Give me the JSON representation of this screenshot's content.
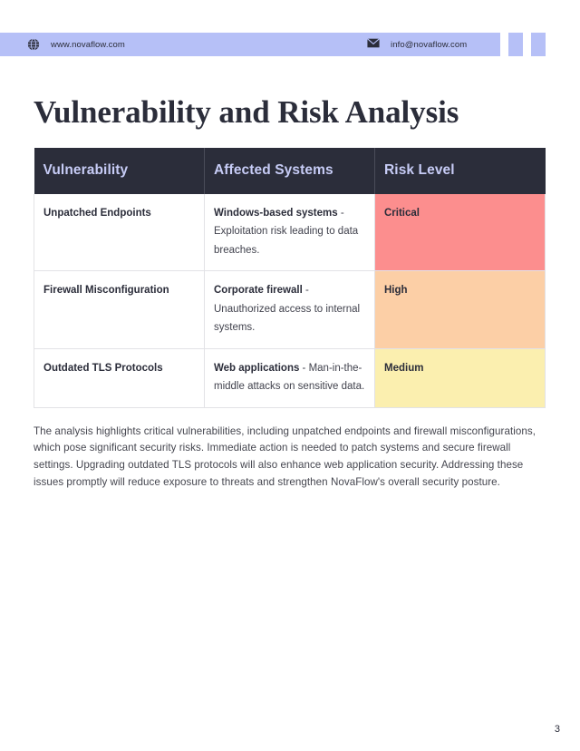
{
  "header": {
    "website_icon": "globe-icon",
    "website": "www.novaflow.com",
    "email_icon": "envelope-icon",
    "email": "info@novaflow.com",
    "bar_color": "#b6c0f7"
  },
  "title": "Vulnerability and Risk Analysis",
  "table": {
    "columns": [
      "Vulnerability",
      "Affected Systems",
      "Risk Level"
    ],
    "header_bg": "#2b2d3a",
    "header_text_color": "#c7ccf6",
    "rows": [
      {
        "vulnerability": "Unpatched Endpoints",
        "system_lead": "Windows-based systems",
        "system_detail": " - Exploitation risk leading to data breaches.",
        "risk": "Critical",
        "risk_color": "#fc8e8e",
        "risk_class": "sev-critical"
      },
      {
        "vulnerability": "Firewall Misconfiguration",
        "system_lead": "Corporate firewall",
        "system_detail": " - Unauthorized access to internal systems.",
        "risk": "High",
        "risk_color": "#fccfa6",
        "risk_class": "sev-high"
      },
      {
        "vulnerability": "Outdated TLS Protocols",
        "system_lead": "Web applications",
        "system_detail": " - Man-in-the-middle attacks on sensitive data.",
        "risk": "Medium",
        "risk_color": "#fbefaf",
        "risk_class": "sev-medium"
      }
    ]
  },
  "summary": "The analysis highlights critical vulnerabilities, including unpatched endpoints and firewall misconfigurations, which pose significant security risks. Immediate action is needed to patch systems and secure firewall settings. Upgrading outdated TLS protocols will also enhance web application security. Addressing these issues promptly will reduce exposure to threats and strengthen NovaFlow's overall security posture.",
  "page_number": "3"
}
